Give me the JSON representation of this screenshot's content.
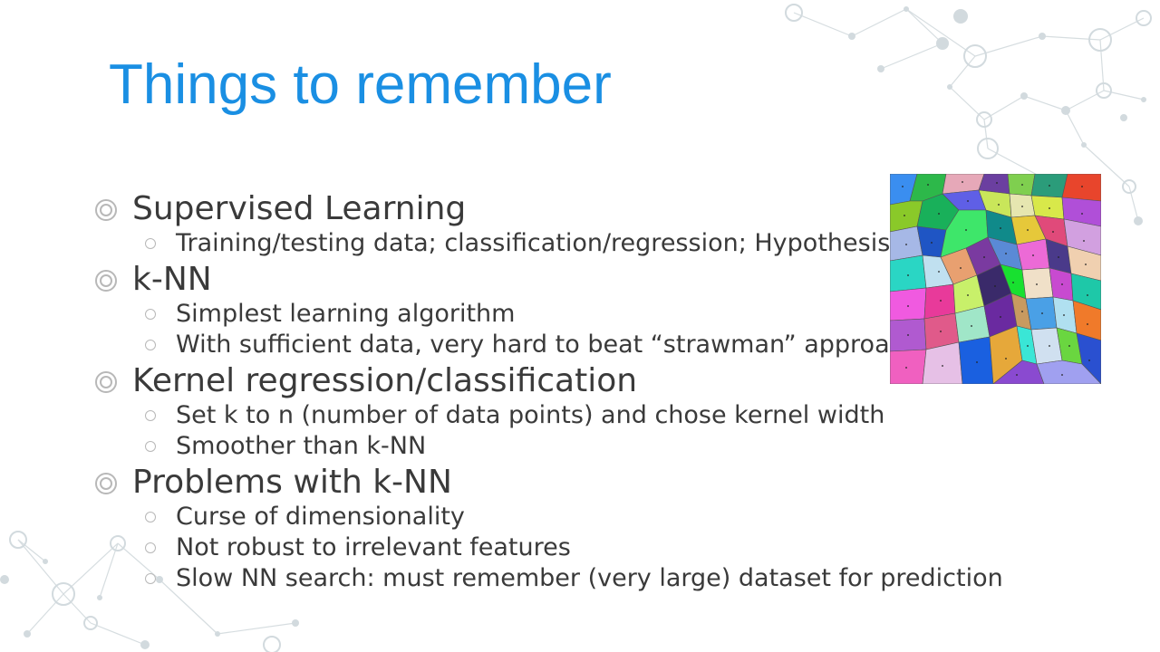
{
  "slide": {
    "title": "Things to remember",
    "sections": [
      {
        "heading": "Supervised Learning",
        "items": [
          "Training/testing data; classification/regression; Hypothesis"
        ]
      },
      {
        "heading": "k-NN",
        "items": [
          "Simplest learning algorithm",
          "With sufficient data, very hard to beat “strawman” approac"
        ]
      },
      {
        "heading": "Kernel regression/classification",
        "items": [
          "Set k to n (number of data points) and chose kernel width",
          "Smoother than k-NN"
        ]
      },
      {
        "heading": "Problems with k-NN",
        "items": [
          "Curse of dimensionality",
          "Not robust to irrelevant features",
          "Slow NN search: must remember (very large) dataset for prediction"
        ]
      }
    ]
  },
  "colors": {
    "title": "#1a8fe3",
    "text": "#3a3a3a",
    "decoration": "#cfd8dc"
  },
  "image": {
    "name": "voronoi-diagram"
  }
}
